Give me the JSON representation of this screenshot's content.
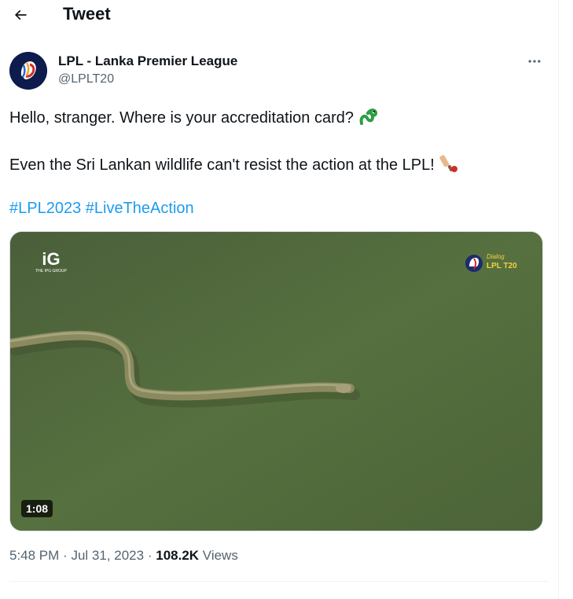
{
  "header": {
    "title": "Tweet",
    "back_icon": "back-arrow-icon"
  },
  "author": {
    "name": "LPL - Lanka Premier League",
    "handle": "@LPLT20",
    "avatar": "lpl-lion-logo"
  },
  "tweet": {
    "line1": "Hello, stranger. Where is your accreditation card?",
    "line1_emoji": "snake",
    "line2": "Even the Sri Lankan wildlife can't resist the action at the LPL!",
    "line2_emoji": "cricket-bat",
    "hashtags": [
      "#LPL2023",
      "#LiveTheAction"
    ]
  },
  "media": {
    "type": "video",
    "duration": "1:08",
    "watermark_left": "THE IPG GROUP",
    "watermark_right": "LPL T20"
  },
  "meta": {
    "time": "5:48 PM",
    "separator": "·",
    "date": "Jul 31, 2023",
    "views_count": "108.2K",
    "views_label": "Views"
  },
  "colors": {
    "link": "#1d9bf0",
    "secondary_text": "#536471",
    "primary_text": "#0f1419"
  }
}
